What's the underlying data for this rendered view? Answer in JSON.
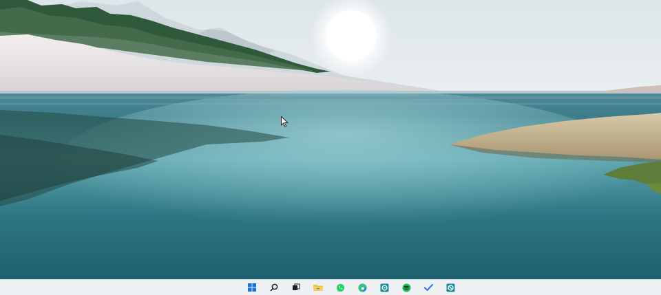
{
  "desktop": {
    "wallpaper_icon": "lake-landscape-wallpaper",
    "cursor_icon": "mouse-pointer-icon"
  },
  "taskbar": {
    "items": [
      {
        "name": "start-button",
        "icon": "windows-logo-icon",
        "color": "#1a73d9"
      },
      {
        "name": "search-button",
        "icon": "search-icon",
        "color": "#1f1f1f"
      },
      {
        "name": "task-view-button",
        "icon": "task-view-icon",
        "color": "#1f1f1f"
      },
      {
        "name": "file-explorer-button",
        "icon": "folder-icon",
        "color": "#f2c43d"
      },
      {
        "name": "whatsapp-button",
        "icon": "whatsapp-icon",
        "color": "#25d366"
      },
      {
        "name": "edge-button",
        "icon": "edge-browser-icon",
        "color": "#1f8ad6"
      },
      {
        "name": "app-button-1",
        "icon": "teal-app-icon",
        "color": "#1b8a94"
      },
      {
        "name": "spotify-button",
        "icon": "spotify-icon",
        "color": "#1db954"
      },
      {
        "name": "todo-button",
        "icon": "checkmark-icon",
        "color": "#2f7de1"
      },
      {
        "name": "app-button-2",
        "icon": "blocked-app-icon",
        "color": "#1b8a94"
      }
    ]
  }
}
